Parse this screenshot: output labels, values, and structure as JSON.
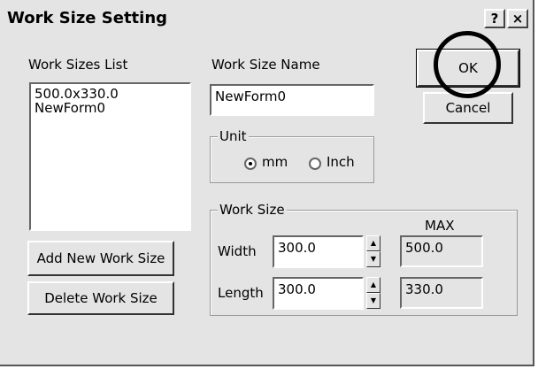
{
  "dialog": {
    "title": "Work Size Setting",
    "help_glyph": "?",
    "close_glyph": "×"
  },
  "list": {
    "label": "Work Sizes List",
    "items": [
      "500.0x330.0",
      "NewForm0"
    ]
  },
  "name": {
    "label": "Work Size Name",
    "value": "NewForm0"
  },
  "buttons": {
    "ok": "OK",
    "cancel": "Cancel",
    "add": "Add New Work Size",
    "delete": "Delete Work Size"
  },
  "unit": {
    "legend": "Unit",
    "options": [
      "mm",
      "Inch"
    ],
    "selected": "mm"
  },
  "work_size": {
    "legend": "Work Size",
    "max_label": "MAX",
    "width_label": "Width",
    "width_value": "300.0",
    "width_max": "500.0",
    "length_label": "Length",
    "length_value": "300.0",
    "length_max": "330.0"
  }
}
